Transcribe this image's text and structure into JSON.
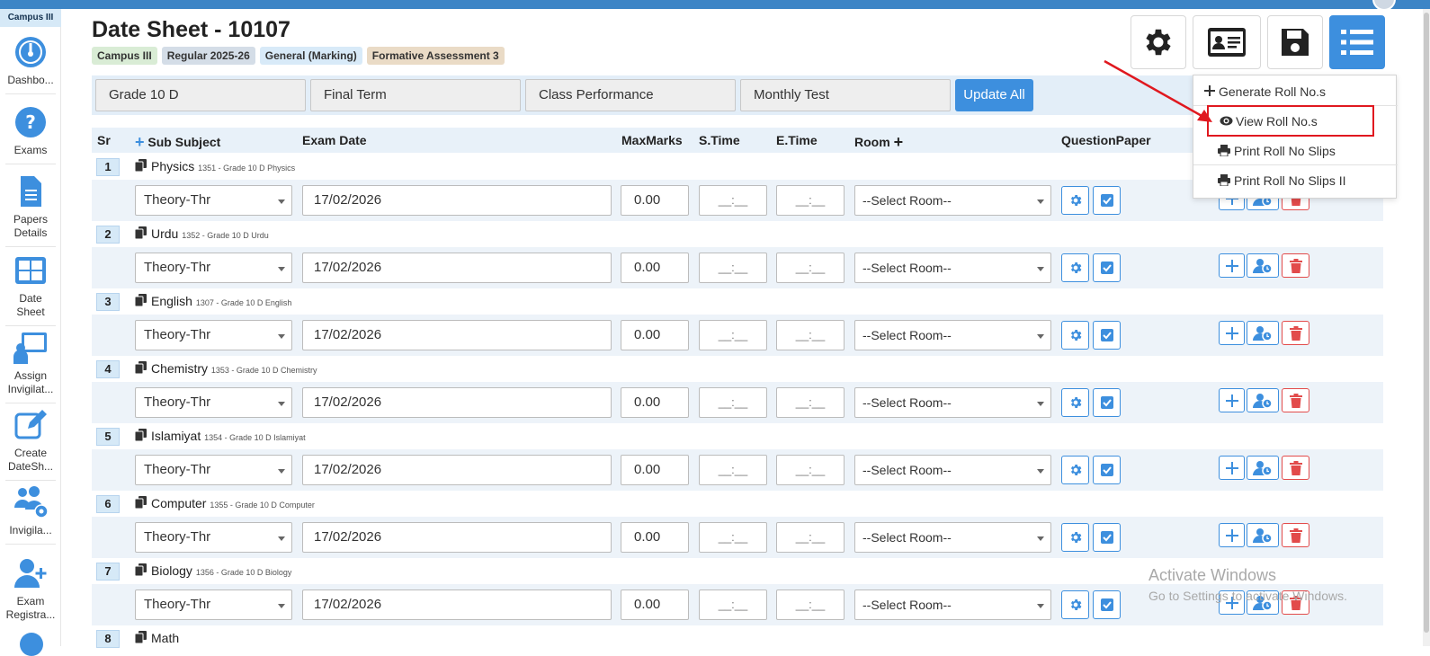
{
  "campus_badge": "Campus III",
  "sidebar": [
    {
      "label": "Dashbo...",
      "icon": "dashboard-icon"
    },
    {
      "label": "Exams",
      "icon": "question-icon"
    },
    {
      "label": "Papers Details",
      "icon": "document-icon"
    },
    {
      "label": "Date Sheet",
      "icon": "grid-icon"
    },
    {
      "label": "Assign Invigilat...",
      "icon": "teacher-board-icon"
    },
    {
      "label": "Create DateSh...",
      "icon": "edit-icon"
    },
    {
      "label": "Invigila...",
      "icon": "users-gear-icon"
    },
    {
      "label": "Exam Registra...",
      "icon": "user-plus-icon"
    }
  ],
  "header": {
    "title": "Date Sheet - 10107",
    "tags": [
      "Campus III",
      "Regular 2025-26",
      "General (Marking)",
      "Formative Assessment 3"
    ]
  },
  "filters": {
    "grade": "Grade 10 D",
    "term": "Final Term",
    "performance": "Class Performance",
    "test": "Monthly Test",
    "update_label": "Update All"
  },
  "table": {
    "headers": {
      "sr": "Sr",
      "sub_subject": "Sub Subject",
      "exam_date": "Exam Date",
      "max_marks": "MaxMarks",
      "s_time": "S.Time",
      "e_time": "E.Time",
      "room": "Room",
      "question_paper": "QuestionPaper"
    },
    "rows": [
      {
        "sr": "1",
        "subject": "Physics",
        "code": "1351 - Grade 10 D Physics",
        "type": "Theory-Thr",
        "date": "17/02/2026",
        "marks": "0.00",
        "stime": "__:__",
        "etime": "__:__",
        "room": "--Select Room--"
      },
      {
        "sr": "2",
        "subject": "Urdu",
        "code": "1352 - Grade 10 D Urdu",
        "type": "Theory-Thr",
        "date": "17/02/2026",
        "marks": "0.00",
        "stime": "__:__",
        "etime": "__:__",
        "room": "--Select Room--"
      },
      {
        "sr": "3",
        "subject": "English",
        "code": "1307 - Grade 10 D English",
        "type": "Theory-Thr",
        "date": "17/02/2026",
        "marks": "0.00",
        "stime": "__:__",
        "etime": "__:__",
        "room": "--Select Room--"
      },
      {
        "sr": "4",
        "subject": "Chemistry",
        "code": "1353 - Grade 10 D Chemistry",
        "type": "Theory-Thr",
        "date": "17/02/2026",
        "marks": "0.00",
        "stime": "__:__",
        "etime": "__:__",
        "room": "--Select Room--"
      },
      {
        "sr": "5",
        "subject": "Islamiyat",
        "code": "1354 - Grade 10 D Islamiyat",
        "type": "Theory-Thr",
        "date": "17/02/2026",
        "marks": "0.00",
        "stime": "__:__",
        "etime": "__:__",
        "room": "--Select Room--"
      },
      {
        "sr": "6",
        "subject": "Computer",
        "code": "1355 - Grade 10 D Computer",
        "type": "Theory-Thr",
        "date": "17/02/2026",
        "marks": "0.00",
        "stime": "__:__",
        "etime": "__:__",
        "room": "--Select Room--"
      },
      {
        "sr": "7",
        "subject": "Biology",
        "code": "1356 - Grade 10 D Biology",
        "type": "Theory-Thr",
        "date": "17/02/2026",
        "marks": "0.00",
        "stime": "__:__",
        "etime": "__:__",
        "room": "--Select Room--"
      },
      {
        "sr": "8",
        "subject": "Math",
        "code": "",
        "type": "",
        "date": "",
        "marks": "",
        "stime": "",
        "etime": "",
        "room": ""
      }
    ]
  },
  "menu": {
    "items": [
      {
        "label": "Generate Roll No.s",
        "icon": "plus-icon"
      },
      {
        "label": "View Roll No.s",
        "icon": "eye-icon"
      },
      {
        "label": "Print Roll No Slips",
        "icon": "printer-icon"
      },
      {
        "label": "Print Roll No Slips II",
        "icon": "printer-icon"
      }
    ],
    "highlighted": "View Roll No.s"
  },
  "watermark": {
    "line1": "Activate Windows",
    "line2": "Go to Settings to activate Windows."
  },
  "colors": {
    "primary": "#3d8fde",
    "danger": "#e24b4b",
    "highlight": "#e0181f"
  }
}
